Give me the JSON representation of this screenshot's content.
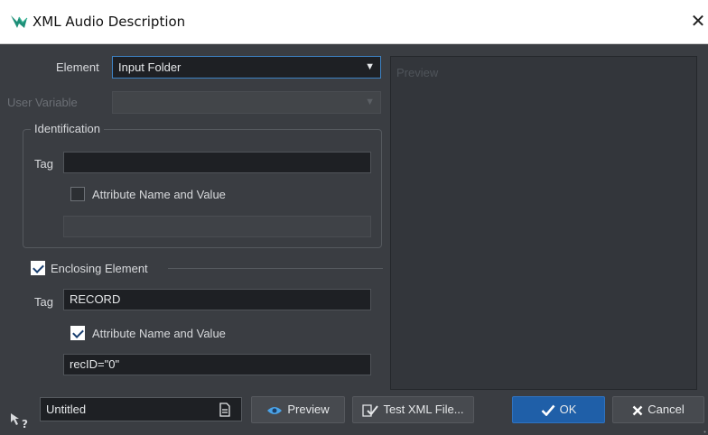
{
  "window": {
    "title": "XML Audio Description",
    "close_glyph": "✕"
  },
  "element_row": {
    "label": "Element",
    "value": "Input Folder"
  },
  "user_variable_row": {
    "label": "User Variable",
    "value": ""
  },
  "identification": {
    "legend": "Identification",
    "tag_label": "Tag",
    "tag_value": "",
    "attribute_checkbox_label": "Attribute Name and Value",
    "attribute_checked": false,
    "attribute_value": ""
  },
  "enclosing": {
    "checkbox_label": "Enclosing Element",
    "checked": true,
    "tag_label": "Tag",
    "tag_value": "RECORD",
    "attribute_checkbox_label": "Attribute Name and Value",
    "attribute_checked": true,
    "attribute_value": "recID=\"0\""
  },
  "preview_pane": {
    "placeholder": "Preview"
  },
  "footer": {
    "preset_name": "Untitled",
    "preview_button": "Preview",
    "test_button": "Test XML File...",
    "ok_button": "OK",
    "cancel_button": "Cancel"
  },
  "icons": {
    "app": "wavelab-logo-icon",
    "preset": "document-icon",
    "preview": "eye-icon",
    "test": "checklist-icon",
    "ok": "checkmark-icon",
    "cancel": "x-icon",
    "help": "help-icon"
  },
  "colors": {
    "background": "#3a3d42",
    "field": "#1e2024",
    "accent": "#1f5fa8",
    "select_border": "#3d82c4"
  }
}
